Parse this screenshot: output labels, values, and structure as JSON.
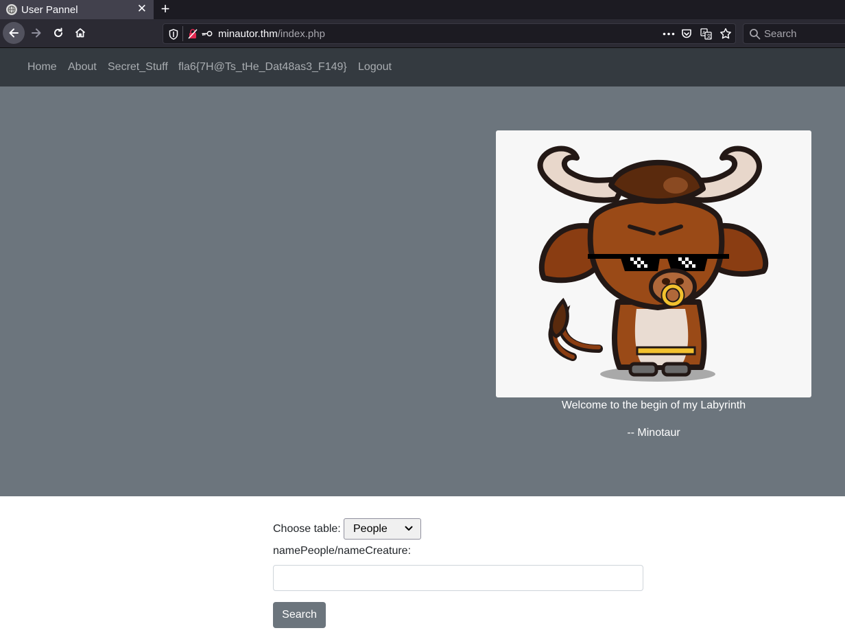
{
  "browser": {
    "tab_title": "User Pannel",
    "tab_close": "✕",
    "new_tab": "+",
    "url_host": "minautor.thm",
    "url_path": "/index.php",
    "search_placeholder": "Search"
  },
  "site_nav": {
    "items": [
      "Home",
      "About",
      "Secret_Stuff",
      "fla6{7H@Ts_tHe_Dat48as3_F149}",
      "Logout"
    ]
  },
  "hero": {
    "welcome": "Welcome to the begin of my Labyrinth",
    "signature": "-- Minotaur"
  },
  "form": {
    "choose_label": "Choose table:",
    "selected_table": "People",
    "name_label": "namePeople/nameCreature:",
    "input_value": "",
    "search_button": "Search"
  },
  "colors": {
    "nav_bg": "#343a40",
    "hero_bg": "#6c757d",
    "button_bg": "#6c757d"
  }
}
